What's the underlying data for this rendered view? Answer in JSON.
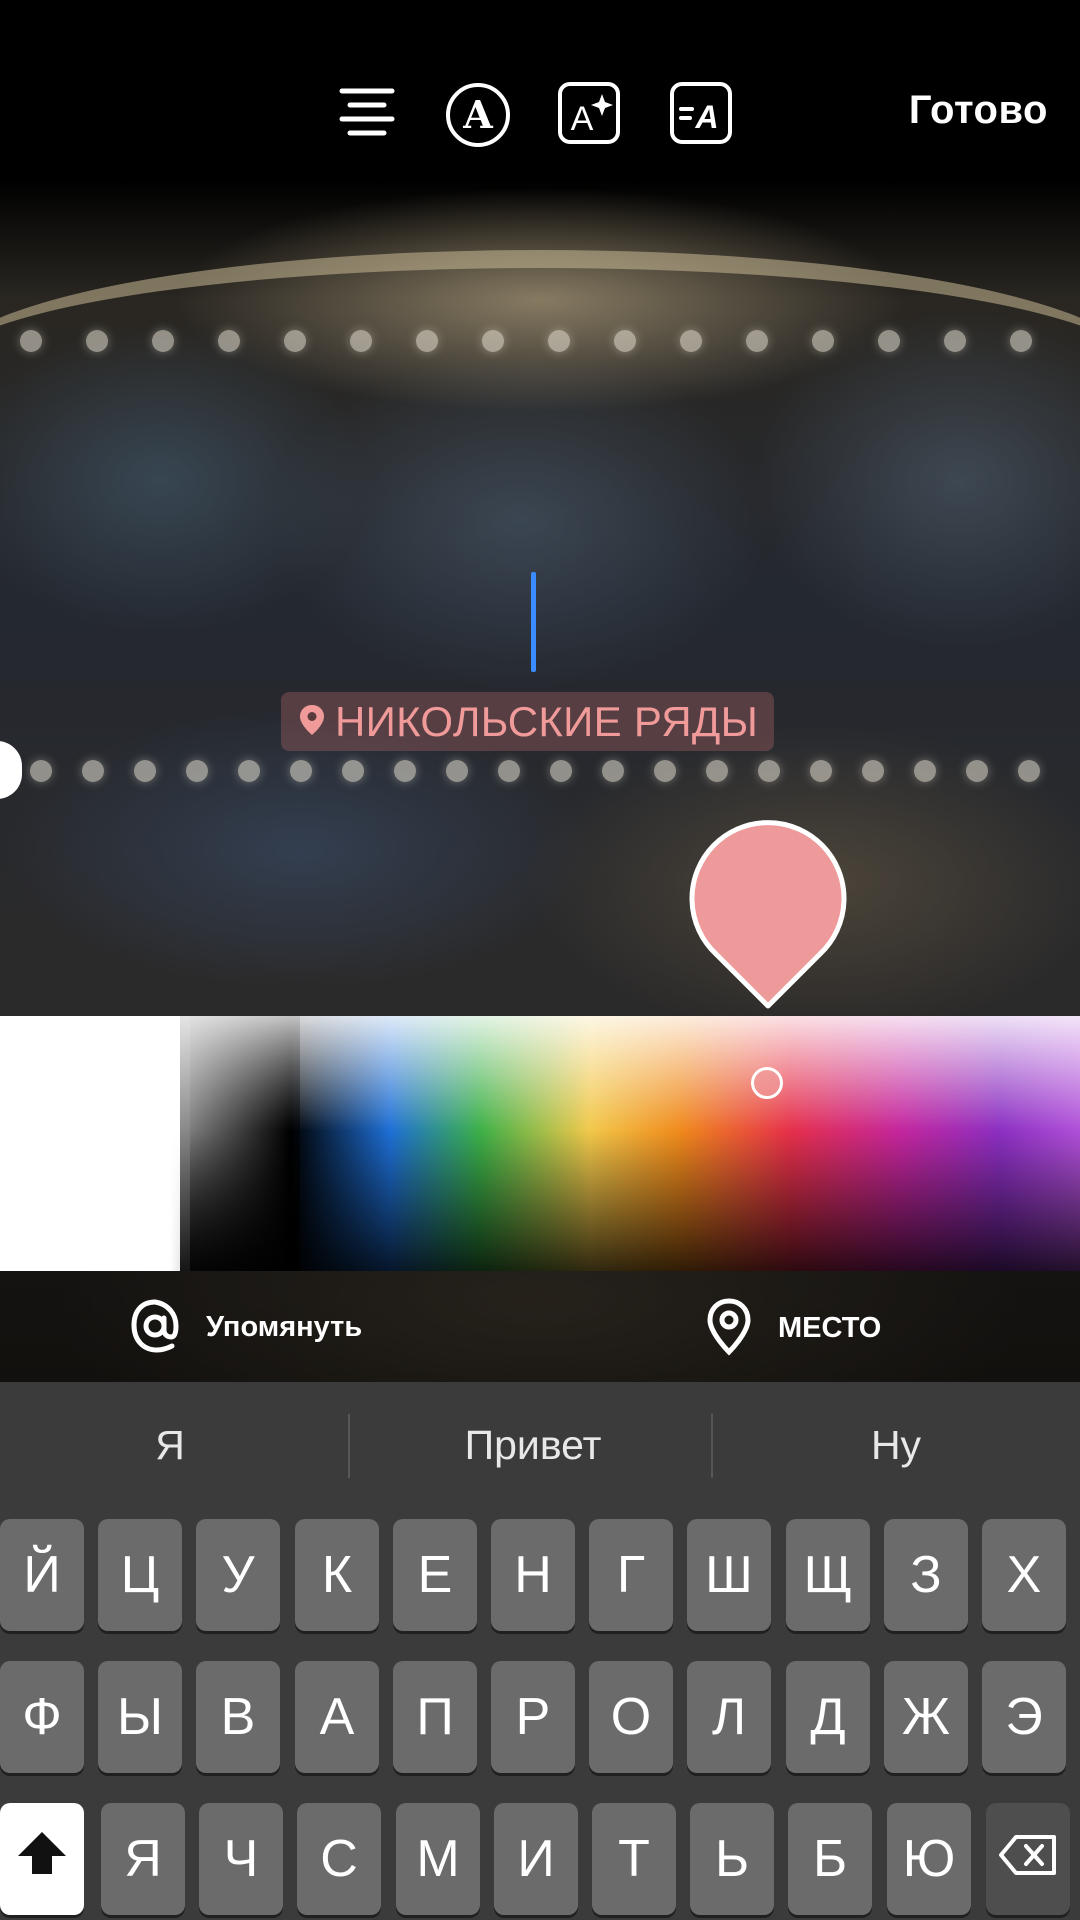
{
  "toolbar": {
    "tools": [
      "align-center-icon",
      "font-style-icon",
      "text-effects-icon",
      "text-animation-icon"
    ],
    "done_label": "Готово"
  },
  "sticker": {
    "icon": "location-pin-icon",
    "text": "НИКОЛЬСКИЕ РЯДЫ",
    "color": "#f09a9a"
  },
  "color_picker": {
    "selected_color": "#ef9a9a"
  },
  "actions": {
    "mention": {
      "icon": "at-icon",
      "label": "Упомянуть"
    },
    "location": {
      "icon": "location-pin-icon",
      "label": "МЕСТО"
    }
  },
  "keyboard": {
    "suggestions": [
      "Я",
      "Привет",
      "Ну"
    ],
    "row1": [
      "Й",
      "Ц",
      "У",
      "К",
      "Е",
      "Н",
      "Г",
      "Ш",
      "Щ",
      "З",
      "Х"
    ],
    "row2": [
      "Ф",
      "Ы",
      "В",
      "А",
      "П",
      "Р",
      "О",
      "Л",
      "Д",
      "Ж",
      "Э"
    ],
    "row3": [
      "Я",
      "Ч",
      "С",
      "М",
      "И",
      "Т",
      "Ь",
      "Б",
      "Ю"
    ],
    "shift_icon": "shift-arrow-icon",
    "backspace_icon": "backspace-icon"
  }
}
